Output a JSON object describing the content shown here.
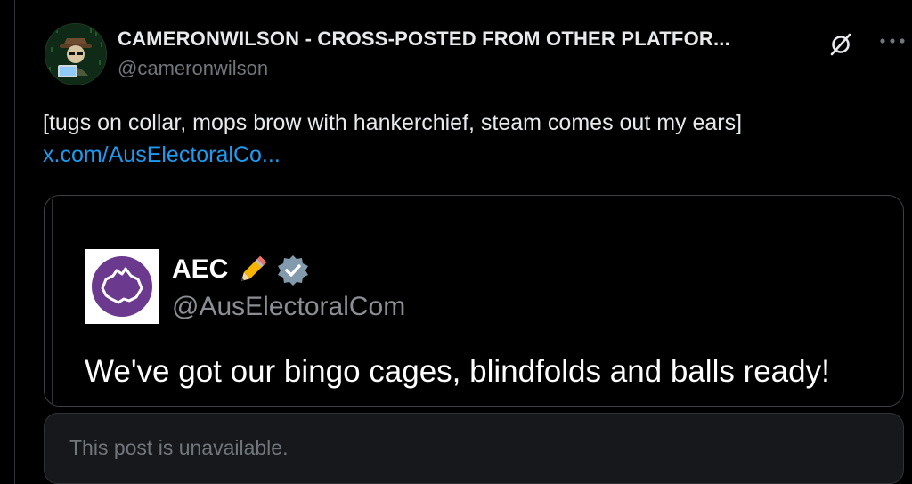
{
  "post": {
    "author_name": "CAMERONWILSON - CROSS-POSTED FROM OTHER PLATFOR...",
    "author_handle": "@cameronwilson",
    "text": "[tugs on collar, mops brow with hankerchief, steam comes out my ears]",
    "link_text": "x.com/AusElectoralCo...",
    "icons": {
      "avatar": "avatar-hacker",
      "unlink": "unlink-icon",
      "more": "more-icon"
    }
  },
  "quoted": {
    "name": "AEC",
    "handle": "@AusElectoralCom",
    "text": "We've got our bingo cages, blindfolds and balls ready!",
    "icons": {
      "pencil": "pencil-emoji-icon",
      "verified": "verified-badge-icon"
    },
    "avatar_color": "#6b3a8f",
    "verified_color": "#829aab"
  },
  "unavailable": {
    "text": "This post is unavailable."
  },
  "colors": {
    "background": "#000000",
    "link": "#1d9bf0",
    "muted": "#71767b",
    "text": "#e7e9ea"
  }
}
